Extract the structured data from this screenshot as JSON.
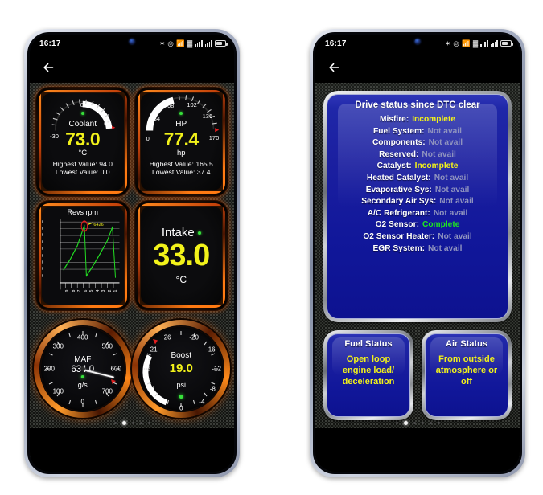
{
  "app": {
    "status_bar": {
      "time": "16:17",
      "icons": [
        "bluetooth-icon",
        "location-icon",
        "wifi-icon",
        "mobile-data-icon",
        "signal-1-icon",
        "signal-2-icon",
        "battery-icon"
      ]
    },
    "back_label": "←"
  },
  "left_screen": {
    "page_dots": {
      "count": 5,
      "active_index": 1
    },
    "widgets": {
      "coolant": {
        "title": "Coolant",
        "value": "73.0",
        "unit": "°C",
        "highest": "Highest Value: 94.0",
        "lowest": "Lowest Value: 0.0",
        "ticks": [
          "-30",
          "0",
          "67"
        ],
        "value_color": "#f2f21a"
      },
      "hp": {
        "title": "HP",
        "value": "77.4",
        "unit": "hp",
        "highest": "Highest Value: 165.5",
        "lowest": "Lowest Value: 37.4",
        "ticks": [
          "0",
          "34",
          "68",
          "102",
          "136",
          "170"
        ],
        "value_color": "#f2f21a"
      },
      "revs": {
        "title": "Revs rpm",
        "marker_value": "6426",
        "y_ticks": [
          "7200",
          "6400",
          "5600",
          "4800",
          "4000",
          "3200",
          "2400",
          "1600",
          "800"
        ],
        "x_ticks": [
          "9",
          "8",
          "7",
          "6",
          "5",
          "4",
          "3",
          "2",
          "1"
        ],
        "line_color": "#22dd22"
      },
      "intake": {
        "title": "Intake",
        "value": "33.0",
        "unit": "°C",
        "value_color": "#f2f21a"
      },
      "maf": {
        "title": "MAF",
        "value": "634.0",
        "unit": "g/s",
        "ticks": [
          "0",
          "100",
          "200",
          "300",
          "400",
          "500",
          "600",
          "700"
        ]
      },
      "boost": {
        "title": "Boost",
        "value": "19.0",
        "unit": "psi",
        "ticks": [
          "0",
          "5",
          "11",
          "16",
          "21",
          "26",
          "-20",
          "-16",
          "-12",
          "-8",
          "-4"
        ],
        "value_color": "#f2f21a"
      }
    }
  },
  "right_screen": {
    "page_dots": {
      "count": 6,
      "active_index": 1
    },
    "drive_status": {
      "title": "Drive status since DTC clear",
      "rows": [
        {
          "label": "Misfire:",
          "value": "Incomplete",
          "state": "incomplete"
        },
        {
          "label": "Fuel System:",
          "value": "Not avail",
          "state": "notavail"
        },
        {
          "label": "Components:",
          "value": "Not avail",
          "state": "notavail"
        },
        {
          "label": "Reserved:",
          "value": "Not avail",
          "state": "notavail"
        },
        {
          "label": "Catalyst:",
          "value": "Incomplete",
          "state": "incomplete"
        },
        {
          "label": "Heated Catalyst:",
          "value": "Not avail",
          "state": "notavail"
        },
        {
          "label": "Evaporative Sys:",
          "value": "Not avail",
          "state": "notavail"
        },
        {
          "label": "Secondary Air Sys:",
          "value": "Not avail",
          "state": "notavail"
        },
        {
          "label": "A/C Refrigerant:",
          "value": "Not avail",
          "state": "notavail"
        },
        {
          "label": "O2 Sensor:",
          "value": "Complete",
          "state": "complete"
        },
        {
          "label": "O2 Sensor Heater:",
          "value": "Not avail",
          "state": "notavail"
        },
        {
          "label": "EGR System:",
          "value": "Not avail",
          "state": "notavail"
        }
      ]
    },
    "fuel_status": {
      "title": "Fuel Status",
      "value": "Open loop engine load/ deceleration"
    },
    "air_status": {
      "title": "Air Status",
      "value": "From outside atmosphere or off"
    }
  },
  "colors": {
    "accent_orange": "#ff7a12",
    "value_yellow": "#f2f21a",
    "complete_green": "#1ee81e",
    "notavail_grey": "#8f93bf",
    "panel_blue": "#171daa"
  },
  "chart_data": {
    "type": "line",
    "title": "Revs rpm",
    "xlabel": "",
    "ylabel": "rpm",
    "ylim": [
      0,
      7600
    ],
    "y_ticks": [
      800,
      1600,
      2400,
      3200,
      4000,
      4800,
      5600,
      6400,
      7200
    ],
    "x_ticks": [
      "9",
      "8",
      "7",
      "6",
      "5",
      "4",
      "3",
      "2",
      "1"
    ],
    "grid": true,
    "legend": "none",
    "annotation": {
      "label": "6426",
      "x_index": 3,
      "y": 6426
    },
    "series": [
      {
        "name": "Revs rpm",
        "color": "#22dd22",
        "x": [
          0,
          1,
          2,
          3,
          4,
          5,
          6,
          7,
          8,
          9
        ],
        "values": [
          2100,
          3400,
          4900,
          6450,
          850,
          2000,
          3400,
          4800,
          6300,
          700
        ]
      }
    ]
  }
}
